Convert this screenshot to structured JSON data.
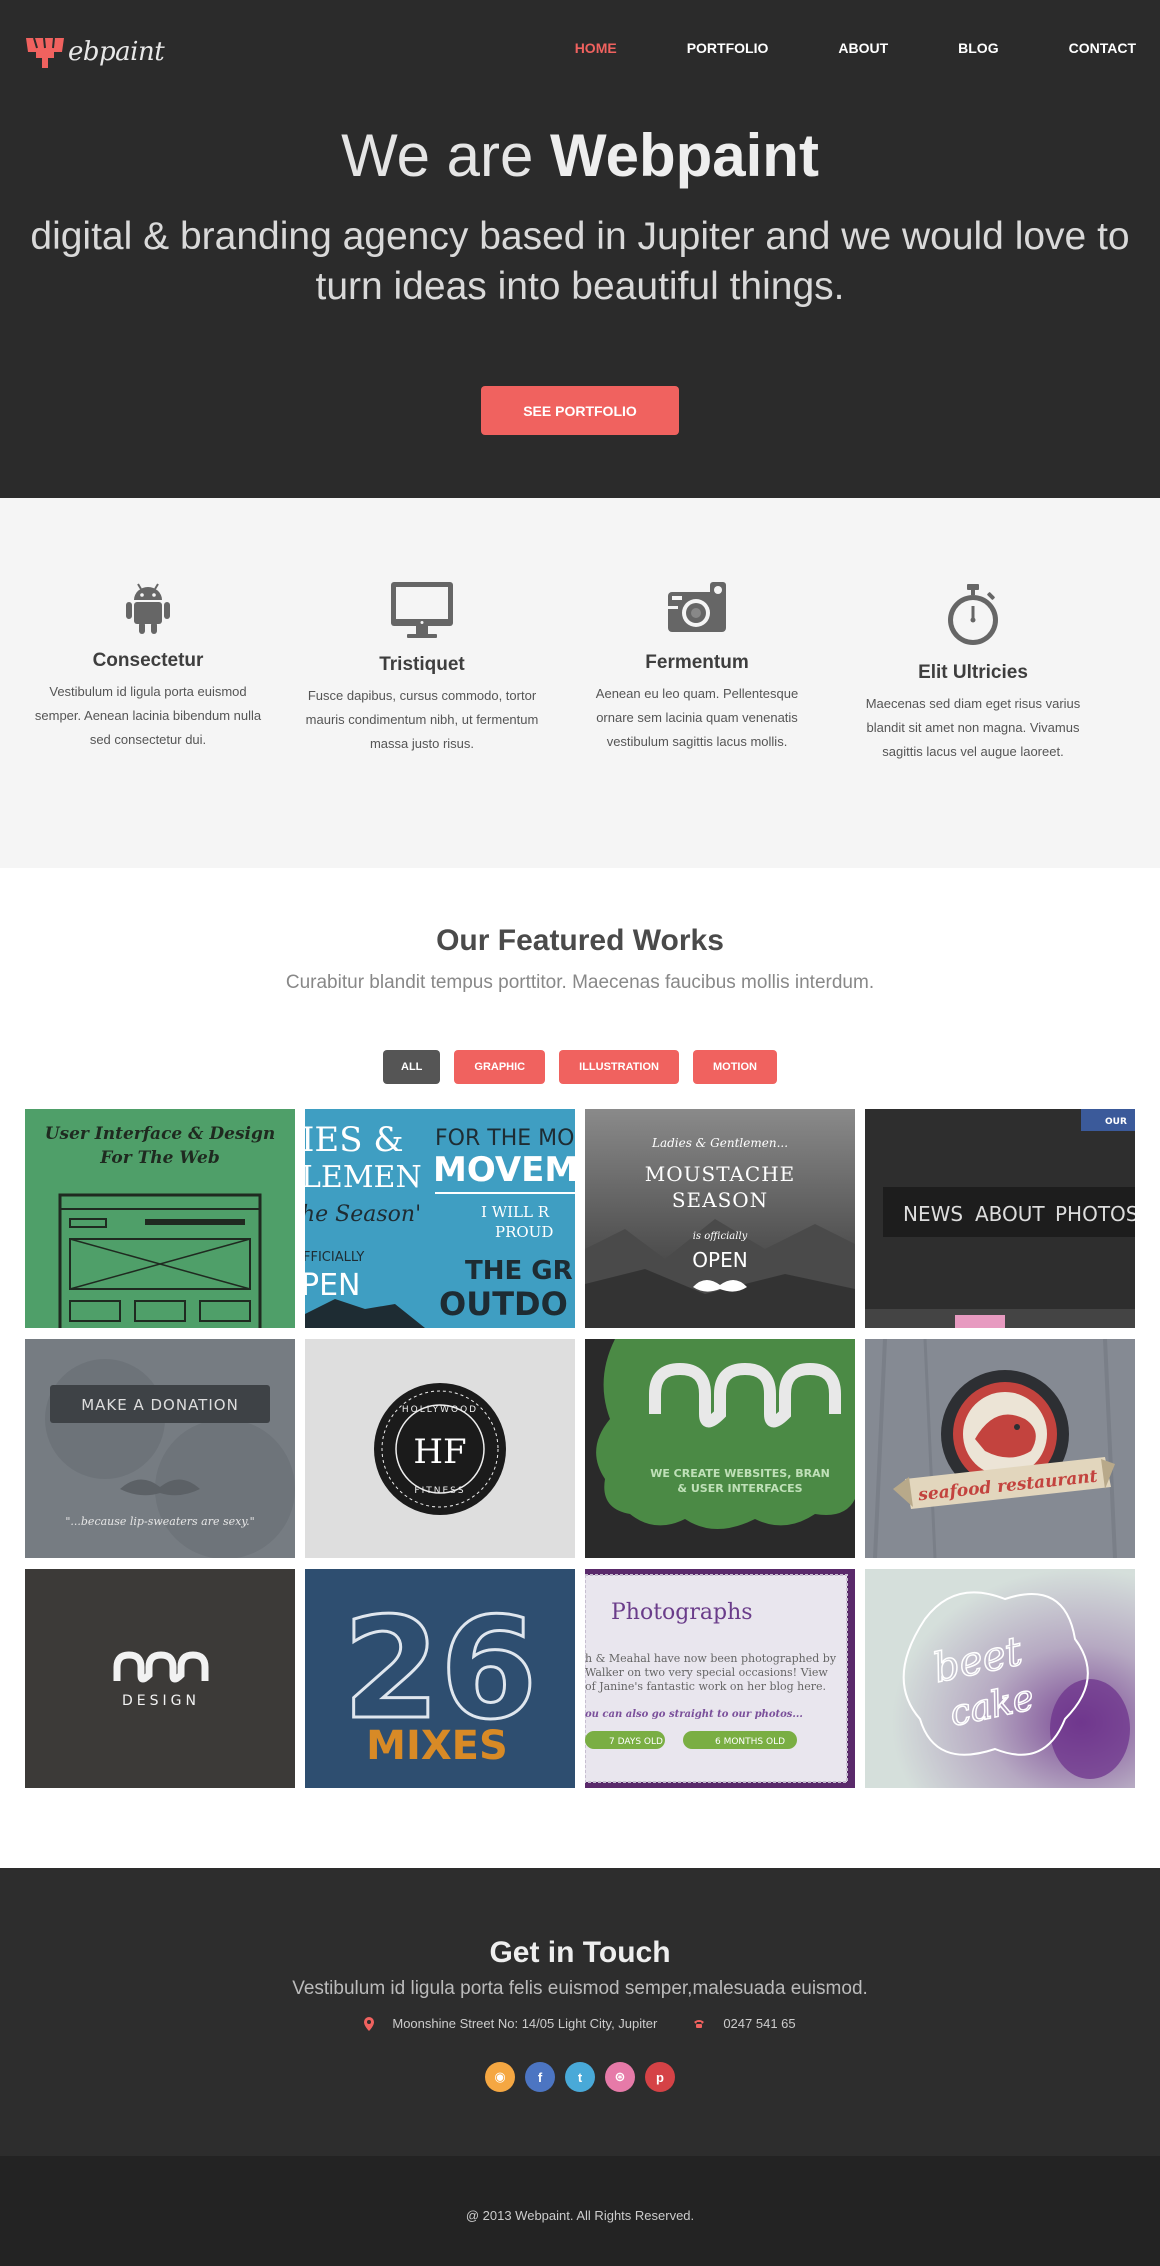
{
  "brand": {
    "name": "ebpaint",
    "accent": "#f0625f"
  },
  "nav": {
    "items": [
      {
        "label": "HOME",
        "active": true
      },
      {
        "label": "PORTFOLIO"
      },
      {
        "label": "ABOUT"
      },
      {
        "label": "BLOG"
      },
      {
        "label": "CONTACT"
      }
    ]
  },
  "hero": {
    "title_light": "We are ",
    "title_bold": "Webpaint",
    "subtitle": "digital & branding agency based in Jupiter and we would love to turn ideas into beautiful things.",
    "button": "SEE PORTFOLIO"
  },
  "features": [
    {
      "icon": "android-icon",
      "title": "Consectetur",
      "text": "Vestibulum id ligula porta euismod semper. Aenean lacinia bibendum nulla sed consectetur dui."
    },
    {
      "icon": "monitor-icon",
      "title": "Tristiquet",
      "text": "Fusce dapibus, cursus commodo, tortor mauris condimentum nibh, ut fermentum massa justo risus."
    },
    {
      "icon": "camera-icon",
      "title": "Fermentum",
      "text": "Aenean eu leo quam. Pellentesque ornare sem lacinia quam venenatis vestibulum sagittis lacus mollis."
    },
    {
      "icon": "stopwatch-icon",
      "title": "Elit Ultricies",
      "text": "Maecenas sed diam eget risus varius blandit sit amet non magna. Vivamus sagittis lacus vel augue laoreet."
    }
  ],
  "works": {
    "title": "Our Featured Works",
    "subtitle": "Curabitur blandit tempus porttitor. Maecenas faucibus mollis interdum.",
    "filters": [
      {
        "label": "ALL",
        "active": true
      },
      {
        "label": "GRAPHIC"
      },
      {
        "label": "ILLUSTRATION"
      },
      {
        "label": "MOTION"
      }
    ],
    "tiles": {
      "t1": {
        "line1": "User Interface & Design",
        "line2": "For The Web"
      },
      "t2": {
        "a": "IES &",
        "b": "LEMEN",
        "c": "FOR THE MO",
        "d": "MOVEM",
        "e": "he Season'",
        "f": "I WILL R",
        "g": "PROUD",
        "h": "FFICIALLY",
        "i": "PEN",
        "j": "THE GR",
        "k": "OUTDO"
      },
      "t3": {
        "a": "Ladies & Gentlemen...",
        "b": "MOUSTACHE",
        "c": "SEASON",
        "d": "is officially",
        "e": "OPEN"
      },
      "t4": {
        "badge": "OUR",
        "n1": "NEWS",
        "n2": "ABOUT",
        "n3": "PHOTOS"
      },
      "t5": {
        "button": "MAKE A DONATION",
        "quote": "\"...because lip-sweaters are sexy.\""
      },
      "t6": {
        "top": "HOLLYWOOD",
        "mono": "HF",
        "bottom": "FITNESS"
      },
      "t7": {
        "l1": "WE CREATE WEBSITES, BRAN",
        "l2": "& USER INTERFACES"
      },
      "t8": {
        "ribbon": "seafood restaurant"
      },
      "t9": {
        "word": "DESIGN"
      },
      "t10": {
        "num": "26",
        "word": "MIXES"
      },
      "t11": {
        "title": "Photographs",
        "l1": "h & Meahal have now been photographed by",
        "l2": "Walker on two very special occasions! View",
        "l3": "of Janine's fantastic work on her blog here.",
        "l4": "ou can also go straight to our photos...",
        "b1": "7 DAYS OLD",
        "b2": "6 MONTHS OLD"
      },
      "t12": {
        "w1": "beet",
        "w2": "cake"
      }
    }
  },
  "contact": {
    "title": "Get in Touch",
    "subtitle": "Vestibulum id ligula porta felis euismod semper,malesuada euismod.",
    "address": "Moonshine Street No: 14/05 Light City, Jupiter",
    "phone": "0247 541 65",
    "socials": [
      {
        "icon": "rss-icon",
        "color": "#f5a742",
        "glyph": "◉"
      },
      {
        "icon": "facebook-icon",
        "color": "#4c75c2",
        "glyph": "f"
      },
      {
        "icon": "twitter-icon",
        "color": "#49a9d8",
        "glyph": "t"
      },
      {
        "icon": "dribbble-icon",
        "color": "#e67aa8",
        "glyph": "⊛"
      },
      {
        "icon": "pinterest-icon",
        "color": "#d54246",
        "glyph": "p"
      }
    ]
  },
  "footer": {
    "text": "@ 2013 Webpaint. All Rights Reserved."
  }
}
